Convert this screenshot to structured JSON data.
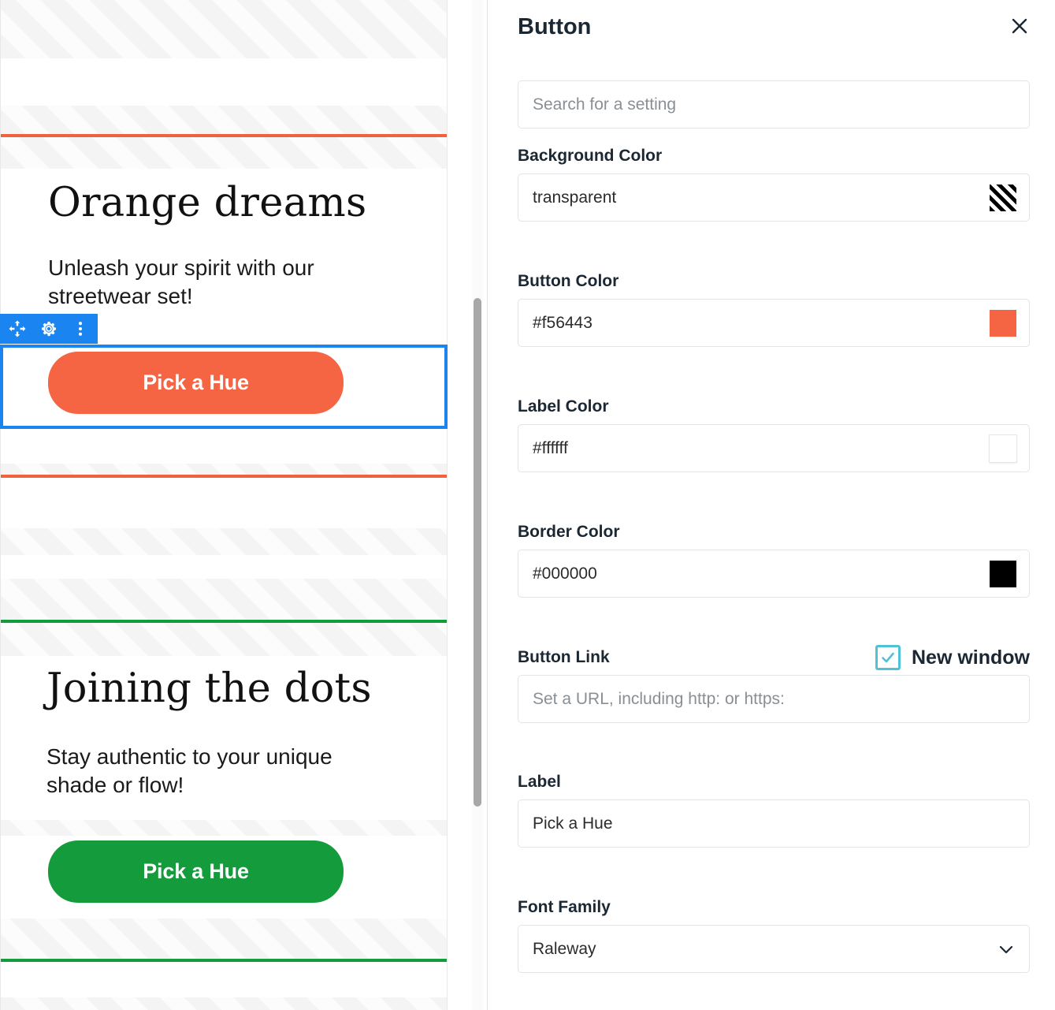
{
  "preview": {
    "scrollbar": {
      "name": "preview-scrollbar"
    },
    "toolbar": {
      "move_icon": "move-arrows-icon",
      "settings_icon": "gear-icon",
      "more_icon": "more-vertical-icon"
    },
    "sections": [
      {
        "id": "orange-dreams",
        "title": "Orange dreams",
        "subtitle": "Unleash your spirit with our streetwear set!",
        "button_label": "Pick a Hue",
        "button_color": "#f56443",
        "rule_color": "#f2613f",
        "selected": true
      },
      {
        "id": "joining-the-dots",
        "title": "Joining the dots",
        "subtitle": "Stay authentic to your unique shade or flow!",
        "button_label": "Pick a Hue",
        "button_color": "#149c3c",
        "rule_color": "#149c3c",
        "selected": false
      }
    ]
  },
  "panel": {
    "title": "Button",
    "close_icon": "close-icon",
    "search": {
      "label": "",
      "placeholder": "Search for a setting",
      "value": ""
    },
    "fields": {
      "background_color": {
        "label": "Background Color",
        "value": "transparent",
        "swatch": "transparent"
      },
      "button_color": {
        "label": "Button Color",
        "value": "#f56443",
        "swatch": "#f56443"
      },
      "label_color": {
        "label": "Label Color",
        "value": "#ffffff",
        "swatch": "#ffffff"
      },
      "border_color": {
        "label": "Border Color",
        "value": "#000000",
        "swatch": "#000000"
      },
      "button_link": {
        "label": "Button Link",
        "placeholder": "Set a URL, including http: or https:",
        "value": "",
        "new_window_label": "New window",
        "new_window_checked": "true",
        "checkbox_color": "#4ec3d6"
      },
      "label": {
        "label": "Label",
        "value": "Pick a Hue"
      },
      "font_family": {
        "label": "Font Family",
        "value": "Raleway",
        "chevron_icon": "chevron-down-icon"
      }
    }
  }
}
